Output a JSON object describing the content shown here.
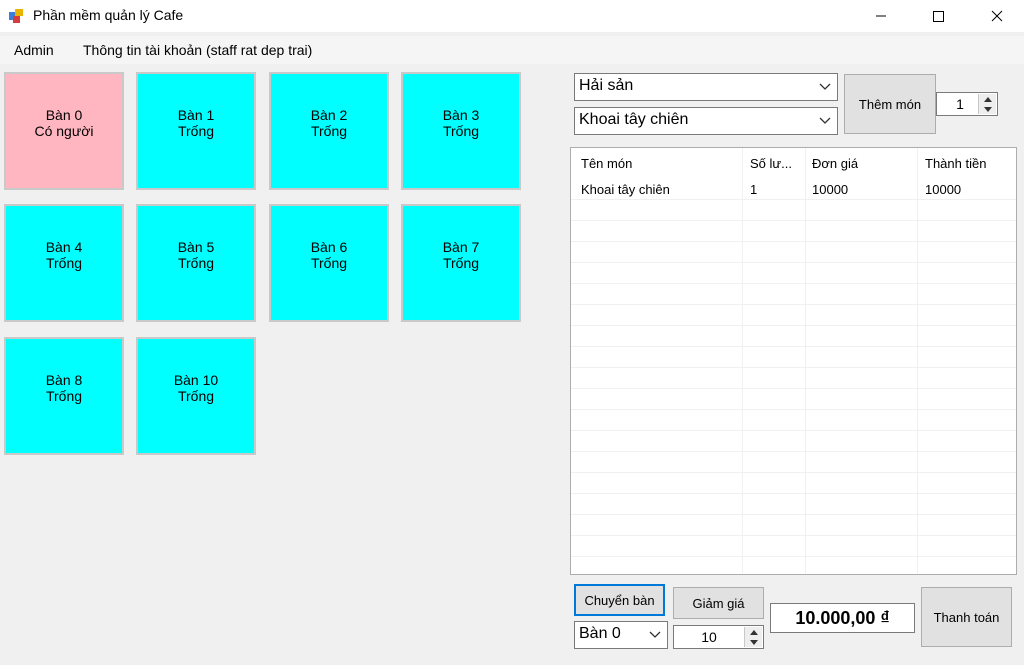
{
  "window": {
    "title": "Phần mềm quản lý Cafe"
  },
  "menu": {
    "admin": "Admin",
    "account": "Thông tin tài khoản (staff rat dep trai)"
  },
  "tables": [
    {
      "name": "Bàn 0",
      "status": "Có người",
      "occupied": true
    },
    {
      "name": "Bàn 1",
      "status": "Trống",
      "occupied": false
    },
    {
      "name": "Bàn 2",
      "status": "Trống",
      "occupied": false
    },
    {
      "name": "Bàn 3",
      "status": "Trống",
      "occupied": false
    },
    {
      "name": "Bàn 4",
      "status": "Trống",
      "occupied": false
    },
    {
      "name": "Bàn 5",
      "status": "Trống",
      "occupied": false
    },
    {
      "name": "Bàn 6",
      "status": "Trống",
      "occupied": false
    },
    {
      "name": "Bàn 7",
      "status": "Trống",
      "occupied": false
    },
    {
      "name": "Bàn 8",
      "status": "Trống",
      "occupied": false
    },
    {
      "name": "Bàn 10",
      "status": "Trống",
      "occupied": false
    }
  ],
  "order": {
    "category": "Hải sản",
    "food": "Khoai tây chiên",
    "add_label": "Thêm món",
    "quantity": "1"
  },
  "bill": {
    "columns": [
      "Tên món",
      "Số lư...",
      "Đơn giá",
      "Thành tiền"
    ],
    "rows": [
      {
        "name": "Khoai tây chiên",
        "qty": "1",
        "price": "10000",
        "total": "10000"
      }
    ]
  },
  "footer": {
    "switch_label": "Chuyển bàn",
    "switch_target": "Bàn 0",
    "discount_label": "Giảm giá",
    "discount_value": "10",
    "total": "10.000,00 ₫",
    "pay_label": "Thanh toán"
  },
  "colors": {
    "empty_table": "#00ffff",
    "occupied_table": "#ffb6c1"
  }
}
